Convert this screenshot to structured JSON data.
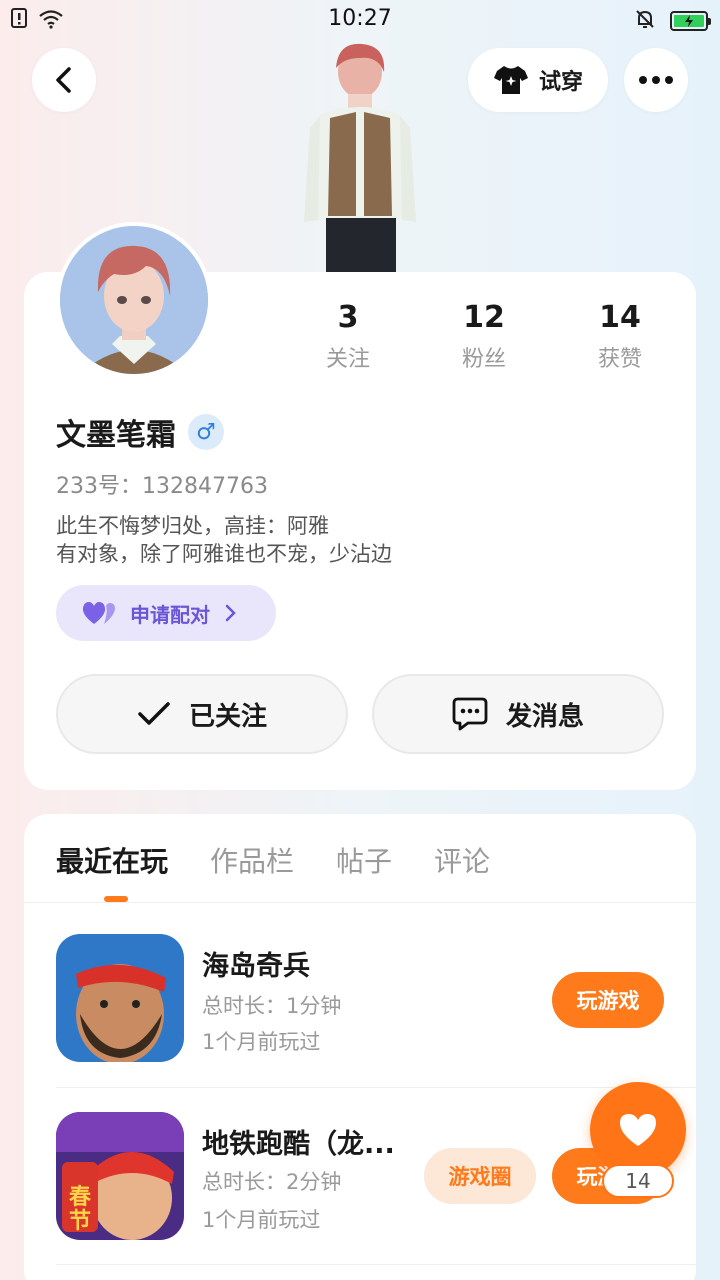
{
  "status_bar": {
    "time": "10:27"
  },
  "header": {
    "try_on_label": "试穿"
  },
  "profile": {
    "name": "文墨笔霜",
    "gender_symbol": "♂",
    "uid_label": "233号：132847763",
    "bio_line1": "此生不悔梦归处，高挂：阿雅",
    "bio_line2": "有对象，除了阿雅谁也不宠，少沾边",
    "pair_label": "申请配对",
    "stats": [
      {
        "value": "3",
        "label": "关注"
      },
      {
        "value": "12",
        "label": "粉丝"
      },
      {
        "value": "14",
        "label": "获赞"
      }
    ],
    "follow_label": "已关注",
    "message_label": "发消息"
  },
  "tabs": [
    "最近在玩",
    "作品栏",
    "帖子",
    "评论"
  ],
  "games": [
    {
      "title": "海岛奇兵",
      "duration": "总时长：1分钟",
      "last_played": "1个月前玩过",
      "play_label": "玩游戏"
    },
    {
      "title": "地铁跑酷（龙...",
      "duration": "总时长：2分钟",
      "last_played": "1个月前玩过",
      "circle_label": "游戏圈",
      "play_label": "玩游戏"
    }
  ],
  "like_fab": {
    "count": "14"
  },
  "colors": {
    "accent": "#ff7a1a",
    "pair_purple": "#6a56d6"
  }
}
